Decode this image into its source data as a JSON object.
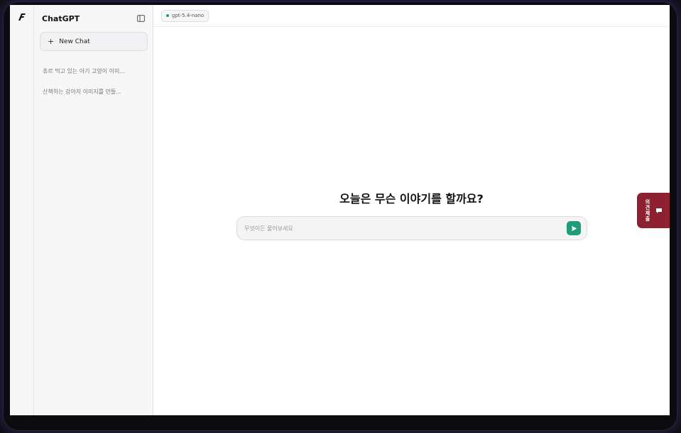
{
  "sidebar": {
    "title": "ChatGPT",
    "new_chat_label": "New Chat",
    "history": [
      {
        "label": "츄르 먹고 있는 아기 고양이 이미..."
      },
      {
        "label": "산책하는 강아지 이미지를 만들..."
      }
    ]
  },
  "topbar": {
    "model_label": "gpt-5.4-nano",
    "model_status_color": "#22a55b"
  },
  "main": {
    "heading": "오늘은 무슨 이야기를 할까요?",
    "input_placeholder": "무엇이든 물어보세요",
    "input_value": ""
  },
  "feedback": {
    "label": "의견제출"
  },
  "colors": {
    "accent": "#1f9d78",
    "feedback_bg": "#8e2131"
  },
  "icons": {
    "logo": "app-logo-icon",
    "sidebar_toggle": "sidebar-toggle-icon",
    "plus": "plus-icon",
    "send": "send-icon",
    "chat": "chat-bubble-icon"
  }
}
